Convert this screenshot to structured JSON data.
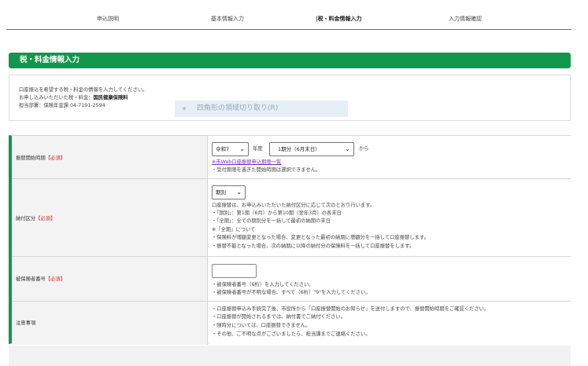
{
  "steps": [
    "申込説明",
    "基本情報入力",
    "税・料金情報入力",
    "入力情報確認"
  ],
  "active_step_prefix": "|",
  "section_title": "税・料金情報入力",
  "info": {
    "line1": "口座振込を希望する税・料金の情報を入力してください。",
    "line2_prefix": "お申し込みいただいた税・料金：",
    "line2_value": "国民健康保険料",
    "line3": "担当部署：保険年金課 04-7191-2594"
  },
  "tooltip": "四角形の領域切り取り(R)",
  "form": {
    "start": {
      "label": "振替開始時期",
      "required": "【必須】",
      "era": "令和7",
      "year_suffix": "年度",
      "period": "1期分（6月末日）",
      "from": "から",
      "link": "※市Web口座振替申込期限一覧",
      "note": "・受付期限を過ぎた開始時期は選択できません。"
    },
    "payment": {
      "label": "納付区分",
      "required": "【必須】",
      "value": "期別",
      "lines": [
        "口座振替は、お申込みいただいた納付区分に応じて次のとおり行います。",
        "・「期別」：第1期（6月）から第10期（翌年3月）の各末日",
        "・「全期」：全ての期別分を一括して最初の納期の末日",
        "※「全期」について",
        "・保険料が増額変更となった場合、変更となった最初の納期に増額分を一括して口座振替します。",
        "・振替不能となった場合、次の納期に以降の納付分の保険料を一括して口座振替をします。"
      ]
    },
    "insured": {
      "label": "被保険者番号",
      "required": "【必須】",
      "value": "",
      "lines": [
        "・被保険者番号（6桁）を入力してください。",
        "・被保険者番号が不明な場合、すべて（6桁）\"9\"を入力してください。"
      ]
    },
    "notes": {
      "label": "注意事項",
      "lines": [
        "・口座振替申込み手続完了後、市役所から「口座振替開始のお知らせ」を送付しますので、振替開始時期をご確認ください。",
        "・口座振替が開始されるまでは、納付書でご納付ください。",
        "・随時分については、口座振替できません。",
        "・その他、ご不明な点がございましたら、担当課までご連絡ください。"
      ]
    }
  }
}
